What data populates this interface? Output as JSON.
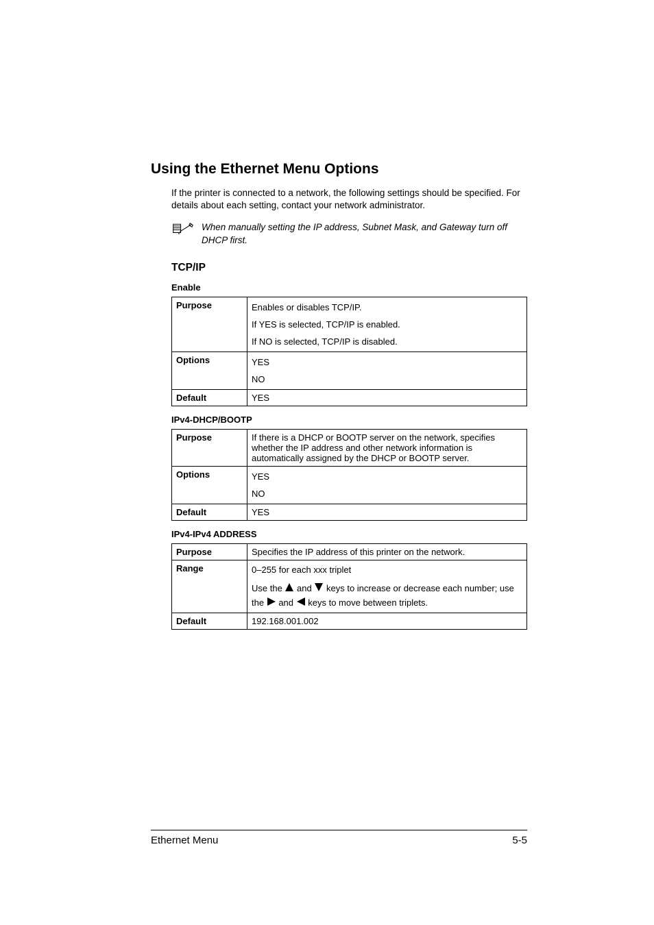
{
  "section_title": "Using the Ethernet Menu Options",
  "intro": "If the printer is connected to a network, the following settings should be specified. For details about each setting, contact your network administrator.",
  "note": "When manually setting the IP address, Subnet Mask, and Gateway turn off DHCP first.",
  "subsection": "TCP/IP",
  "labels": {
    "purpose": "Purpose",
    "options": "Options",
    "default": "Default",
    "range": "Range"
  },
  "tables": {
    "enable": {
      "title": "Enable",
      "purpose_l1": "Enables or disables TCP/IP.",
      "purpose_l2": "If YES is selected, TCP/IP is enabled.",
      "purpose_l3": "If NO is selected, TCP/IP is disabled.",
      "opt1": "YES",
      "opt2": "NO",
      "default": "YES"
    },
    "dhcp": {
      "title": "IPv4-DHCP/BOOTP",
      "purpose": "If there is a DHCP or BOOTP server on the network, specifies whether the IP address and other network information is automatically assigned by the DHCP or BOOTP server.",
      "opt1": "YES",
      "opt2": "NO",
      "default": "YES"
    },
    "ipv4": {
      "title": "IPv4-IPv4 ADDRESS",
      "purpose": "Specifies the IP address of this printer on the network.",
      "range_first": "0–255 for each xxx triplet",
      "range_use_the": "Use the ",
      "range_and": " and ",
      "range_keys_inc": " keys to increase or decrease each number; use the ",
      "range_and2": " and ",
      "range_keys_move": " keys to move between triplets.",
      "default": "192.168.001.002"
    }
  },
  "footer": {
    "left": "Ethernet Menu",
    "right": "5-5"
  }
}
